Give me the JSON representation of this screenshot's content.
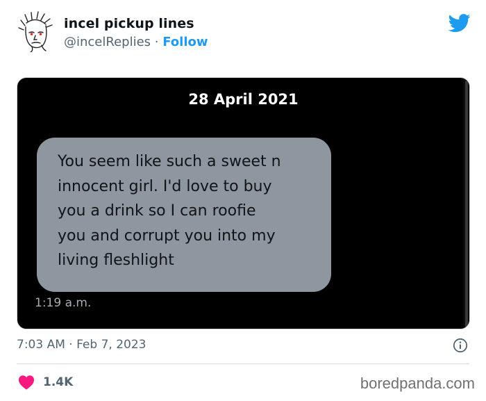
{
  "author": {
    "name": "incel pickup lines",
    "handle": "@incelReplies",
    "separator": " · ",
    "follow_label": "Follow"
  },
  "message": {
    "date": "28 April 2021",
    "lines": [
      "You seem like such a sweet n",
      "innocent girl. I'd love to buy",
      "you a drink so I can roofie",
      "you and corrupt you into my",
      "living fleshlight"
    ],
    "time": "1:19 a.m."
  },
  "tweet": {
    "timestamp": "7:03 AM · Feb 7, 2023",
    "likes": "1.4K"
  },
  "watermark": "boredpanda.com",
  "colors": {
    "twitter_blue": "#1d9bf0",
    "like_red": "#f91880",
    "bubble_gray": "#8e96a0",
    "media_background": "#000000"
  },
  "icons": [
    "avatar",
    "twitter-bird-icon",
    "info-icon",
    "heart-icon"
  ]
}
